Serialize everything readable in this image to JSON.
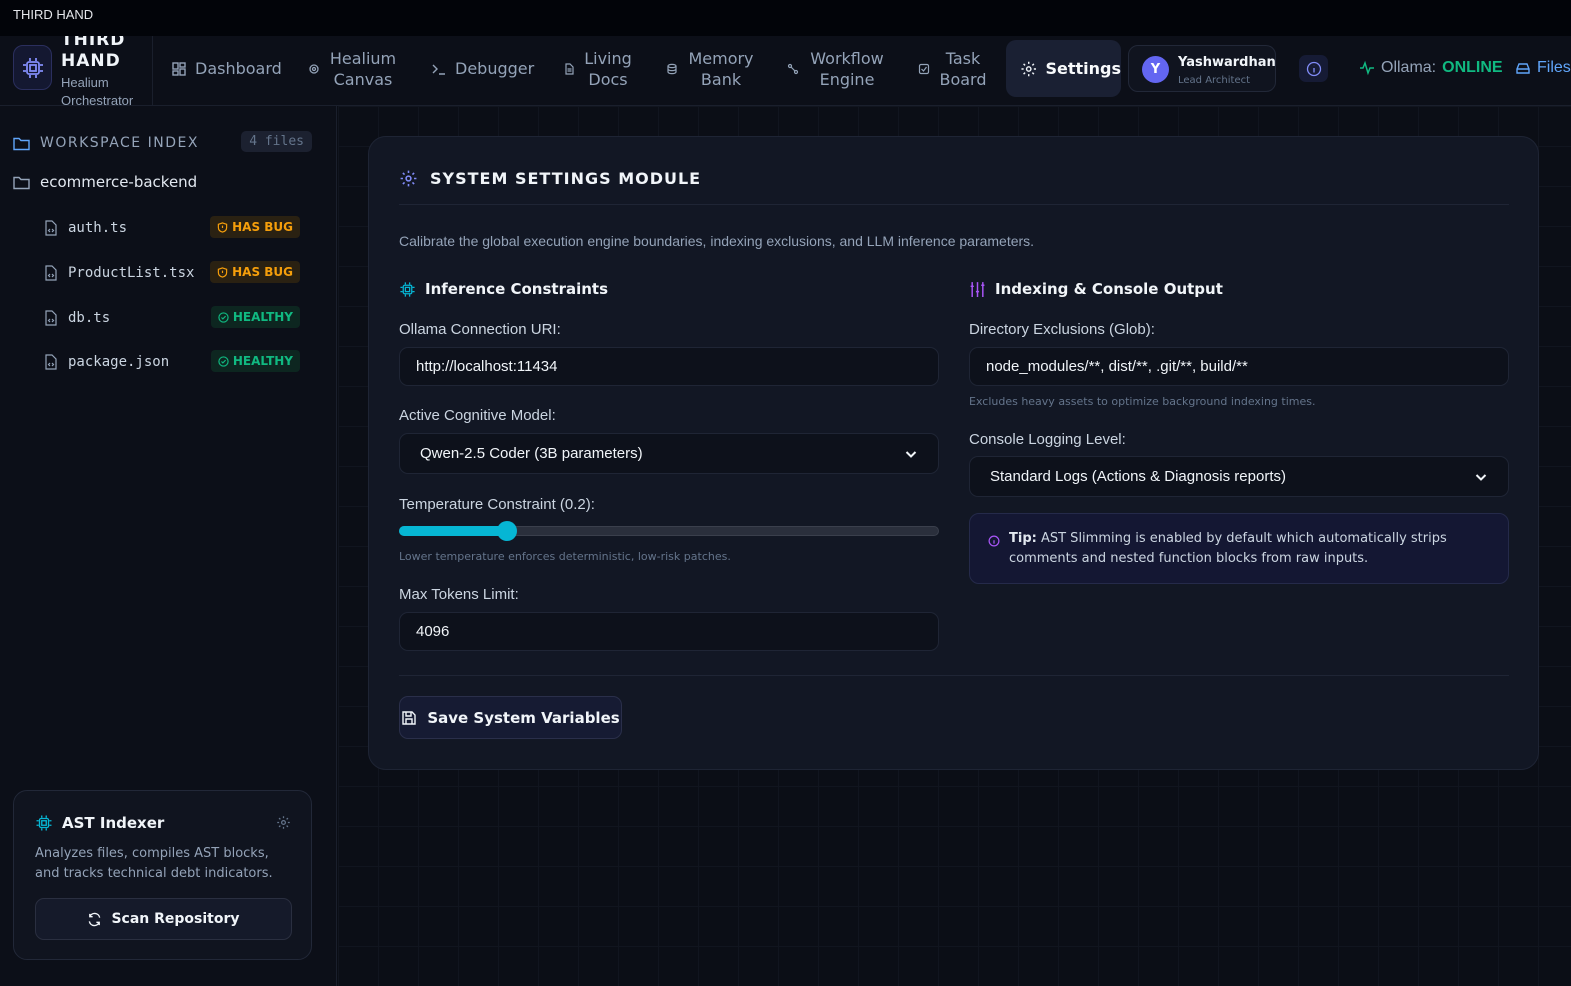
{
  "window": {
    "title": "THIRD HAND"
  },
  "brand": {
    "name": "THIRD HAND",
    "subtitle": "Healium Orchestrator"
  },
  "nav": [
    {
      "label": "Dashboard",
      "icon": "dashboard-icon"
    },
    {
      "label": "Healium Canvas",
      "icon": "canvas-icon"
    },
    {
      "label": "Debugger",
      "icon": "terminal-icon"
    },
    {
      "label": "Living Docs",
      "icon": "document-icon"
    },
    {
      "label": "Memory Bank",
      "icon": "database-icon"
    },
    {
      "label": "Workflow Engine",
      "icon": "workflow-icon"
    },
    {
      "label": "Task Board",
      "icon": "checkbox-icon"
    },
    {
      "label": "Settings",
      "icon": "gear-icon",
      "active": true
    }
  ],
  "user": {
    "initial": "Y",
    "name": "Yashwardhan",
    "role": "Lead Architect"
  },
  "status": {
    "label": "Ollama:",
    "value": "ONLINE"
  },
  "files_link": "Files",
  "sidebar": {
    "workspace_title": "WORKSPACE INDEX",
    "file_count": "4 files",
    "folder": "ecommerce-backend",
    "files": [
      {
        "name": "auth.ts",
        "status": "HAS BUG",
        "type": "bug"
      },
      {
        "name": "ProductList.tsx",
        "status": "HAS BUG",
        "type": "bug"
      },
      {
        "name": "db.ts",
        "status": "HEALTHY",
        "type": "ok"
      },
      {
        "name": "package.json",
        "status": "HEALTHY",
        "type": "ok"
      }
    ],
    "ast": {
      "title": "AST Indexer",
      "description": "Analyzes files, compiles AST blocks, and tracks technical debt indicators.",
      "button": "Scan Repository"
    }
  },
  "settings": {
    "title": "SYSTEM SETTINGS MODULE",
    "description": "Calibrate the global execution engine boundaries, indexing exclusions, and LLM inference parameters.",
    "inference": {
      "title": "Inference Constraints",
      "uri_label": "Ollama Connection URI:",
      "uri_value": "http://localhost:11434",
      "model_label": "Active Cognitive Model:",
      "model_value": "Qwen-2.5 Coder (3B parameters)",
      "temp_label": "Temperature Constraint (0.2):",
      "temp_value": 0.2,
      "temp_hint": "Lower temperature enforces deterministic, low-risk patches.",
      "tokens_label": "Max Tokens Limit:",
      "tokens_value": "4096"
    },
    "indexing": {
      "title": "Indexing & Console Output",
      "exclusions_label": "Directory Exclusions (Glob):",
      "exclusions_value": "node_modules/**, dist/**, .git/**, build/**",
      "exclusions_hint": "Excludes heavy assets to optimize background indexing times.",
      "log_label": "Console Logging Level:",
      "log_value": "Standard Logs (Actions & Diagnosis reports)",
      "tip_label": "Tip:",
      "tip_text": "AST Slimming is enabled by default which automatically strips comments and nested function blocks from raw inputs."
    },
    "save_button": "Save System Variables"
  },
  "colors": {
    "accent": "#06b6d4",
    "online": "#10b981",
    "bug": "#f59e0b",
    "avatar": "#6366f1"
  }
}
